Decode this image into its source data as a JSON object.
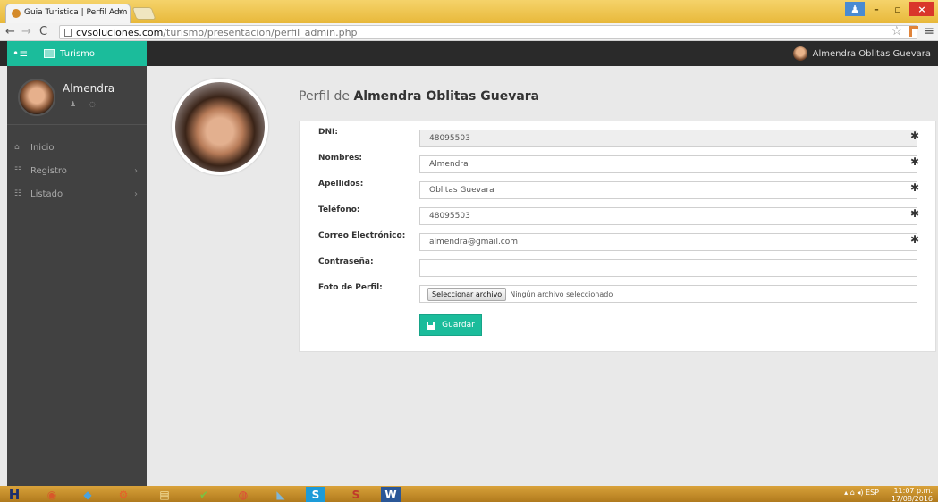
{
  "browser": {
    "tab_title": "Guia Turistica | Perfil Adm",
    "tab_close": "×",
    "url_host": "cvsoluciones.com",
    "url_path": "/turismo/presentacion/perfil_admin.php",
    "icons": [
      "back-icon",
      "forward-icon",
      "reload-icon",
      "page-icon",
      "star-icon",
      "extension-icon",
      "menu-icon"
    ]
  },
  "window_controls": {
    "minimize": "–",
    "maximize": "▫",
    "close": "×"
  },
  "header": {
    "toggle_icon": "•≡",
    "brand": "Turismo",
    "user_name": "Almendra Oblitas Guevara"
  },
  "sidebar": {
    "user_name": "Almendra",
    "user_icons": "♟ ◌",
    "items": [
      {
        "label": "Inicio",
        "icon": "⌂",
        "chevron": ""
      },
      {
        "label": "Registro",
        "icon": "☷",
        "chevron": "›"
      },
      {
        "label": "Listado",
        "icon": "☷",
        "chevron": "›"
      }
    ]
  },
  "page": {
    "title_prefix": "Perfil de",
    "title_name": "Almendra Oblitas Guevara"
  },
  "form": {
    "fields": [
      {
        "label": "DNI:",
        "value": "48095503",
        "required": "✱",
        "readonly": true
      },
      {
        "label": "Nombres:",
        "value": "Almendra",
        "required": "✱"
      },
      {
        "label": "Apellidos:",
        "value": "Oblitas Guevara",
        "required": "✱"
      },
      {
        "label": "Teléfono:",
        "value": "48095503",
        "required": "✱"
      },
      {
        "label": "Correo Electrónico:",
        "value": "almendra@gmail.com",
        "required": "✱"
      },
      {
        "label": "Contraseña:",
        "value": ""
      }
    ],
    "photo_label": "Foto de Perfil:",
    "file_button": "Seleccionar archivo",
    "file_status": "Ningún archivo seleccionado",
    "save_label": "Guardar"
  },
  "taskbar": {
    "apps": [
      "H",
      "◉",
      "◆",
      "⚙",
      "▤",
      "✔",
      "◍",
      "◣",
      "S",
      "S",
      "W"
    ],
    "tray": "▴  ⌂  ◂)   ESP",
    "time": "11:07 p.m.",
    "date": "17/08/2016"
  },
  "colors": {
    "accent": "#1bbc9b",
    "sidebar": "#414141",
    "topbar": "#2a2a2a",
    "taskbar": "#c8901f"
  }
}
